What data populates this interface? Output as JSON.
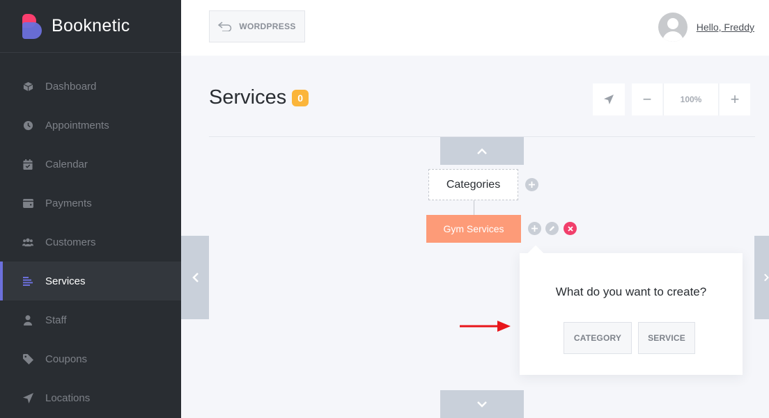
{
  "brand": {
    "name": "Booknetic"
  },
  "sidebar": {
    "items": [
      {
        "label": "Dashboard",
        "icon": "cube-icon"
      },
      {
        "label": "Appointments",
        "icon": "clock-icon"
      },
      {
        "label": "Calendar",
        "icon": "calendar-icon"
      },
      {
        "label": "Payments",
        "icon": "wallet-icon"
      },
      {
        "label": "Customers",
        "icon": "users-icon"
      },
      {
        "label": "Services",
        "icon": "list-icon",
        "active": true
      },
      {
        "label": "Staff",
        "icon": "user-icon"
      },
      {
        "label": "Coupons",
        "icon": "tag-icon"
      },
      {
        "label": "Locations",
        "icon": "location-arrow-icon"
      }
    ]
  },
  "header": {
    "wordpress_label": "WORDPRESS",
    "user_greeting": "Hello, Freddy"
  },
  "page": {
    "title": "Services",
    "count": "0"
  },
  "zoom": {
    "value": "100%",
    "minus": "−",
    "plus": "+"
  },
  "tree": {
    "root_label": "Categories",
    "child_label": "Gym Services"
  },
  "popover": {
    "question": "What do you want to create?",
    "category_label": "CATEGORY",
    "service_label": "SERVICE"
  },
  "colors": {
    "sidebar_bg": "#292d32",
    "accent": "#6c70dc",
    "badge": "#fbb53a",
    "node": "#fd9b78",
    "delete": "#f13f6b",
    "arrow": "#e8161b"
  }
}
